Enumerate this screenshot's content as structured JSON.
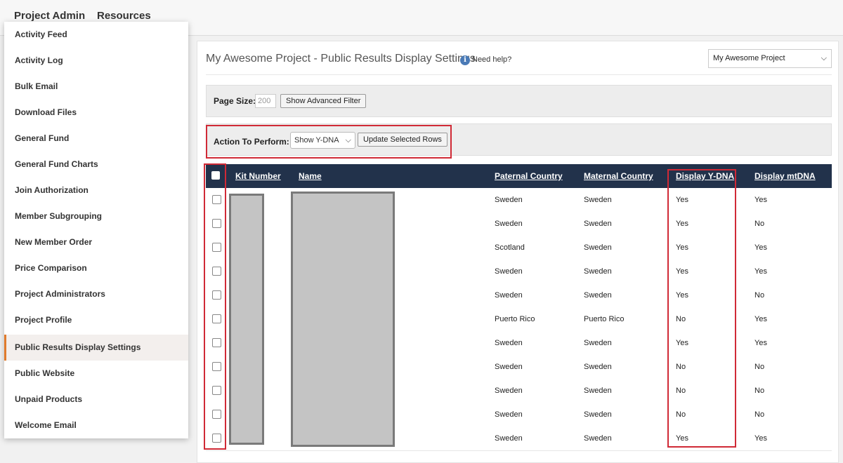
{
  "topnav": {
    "project_admin": "Project Admin",
    "resources": "Resources"
  },
  "menu": {
    "items": [
      "Activity Feed",
      "Activity Log",
      "Bulk Email",
      "Download Files",
      "General Fund",
      "General Fund Charts",
      "Join Authorization",
      "Member Subgrouping",
      "New Member Order",
      "Price Comparison",
      "Project Administrators",
      "Project Profile",
      "Public Results Display Settings",
      "Public Website",
      "Unpaid Products",
      "Welcome Email"
    ],
    "active": "Public Results Display Settings"
  },
  "page": {
    "title": "My Awesome Project - Public Results Display Settings",
    "help_icon": "i",
    "help": "Need help?",
    "project_select": "My Awesome Project"
  },
  "filters": {
    "page_size_label": "Page Size:",
    "page_size_value": "200",
    "advanced_filter": "Show Advanced Filter"
  },
  "action": {
    "label": "Action To Perform:",
    "selected": "Show Y-DNA",
    "update": "Update Selected Rows"
  },
  "table": {
    "headers": {
      "kit": "Kit Number",
      "name": "Name",
      "paternal": "Paternal Country",
      "maternal": "Maternal Country",
      "ydna": "Display Y-DNA",
      "mtdna": "Display mtDNA"
    },
    "rows": [
      {
        "paternal": "Sweden",
        "maternal": "Sweden",
        "ydna": "Yes",
        "mtdna": "Yes"
      },
      {
        "paternal": "Sweden",
        "maternal": "Sweden",
        "ydna": "Yes",
        "mtdna": "No"
      },
      {
        "paternal": "Scotland",
        "maternal": "Sweden",
        "ydna": "Yes",
        "mtdna": "Yes"
      },
      {
        "paternal": "Sweden",
        "maternal": "Sweden",
        "ydna": "Yes",
        "mtdna": "Yes"
      },
      {
        "paternal": "Sweden",
        "maternal": "Sweden",
        "ydna": "Yes",
        "mtdna": "No"
      },
      {
        "paternal": "Puerto Rico",
        "maternal": "Puerto Rico",
        "ydna": "No",
        "mtdna": "Yes"
      },
      {
        "paternal": "Sweden",
        "maternal": "Sweden",
        "ydna": "Yes",
        "mtdna": "Yes"
      },
      {
        "paternal": "Sweden",
        "maternal": "Sweden",
        "ydna": "No",
        "mtdna": "No"
      },
      {
        "paternal": "Sweden",
        "maternal": "Sweden",
        "ydna": "No",
        "mtdna": "No"
      },
      {
        "paternal": "Sweden",
        "maternal": "Sweden",
        "ydna": "No",
        "mtdna": "No"
      },
      {
        "paternal": "Sweden",
        "maternal": "Sweden",
        "ydna": "Yes",
        "mtdna": "Yes"
      }
    ]
  },
  "colors": {
    "header_bg": "#22324b",
    "highlight": "#d02a36",
    "active_accent": "#e07b2d"
  }
}
